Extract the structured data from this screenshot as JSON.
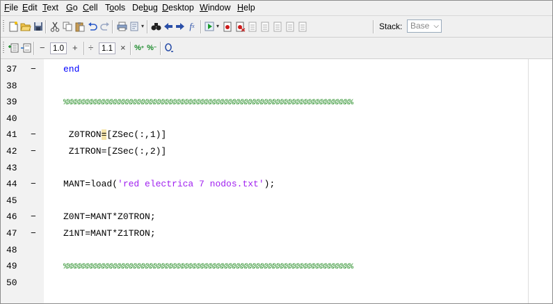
{
  "menu": [
    {
      "pre": "",
      "u": "F",
      "post": "ile"
    },
    {
      "pre": "",
      "u": "E",
      "post": "dit"
    },
    {
      "pre": "",
      "u": "T",
      "post": "ext"
    },
    {
      "pre": "",
      "u": "G",
      "post": "o"
    },
    {
      "pre": "",
      "u": "C",
      "post": "ell"
    },
    {
      "pre": "T",
      "u": "o",
      "post": "ols"
    },
    {
      "pre": "De",
      "u": "b",
      "post": "ug"
    },
    {
      "pre": "",
      "u": "D",
      "post": "esktop"
    },
    {
      "pre": "",
      "u": "W",
      "post": "indow"
    },
    {
      "pre": "",
      "u": "H",
      "post": "elp"
    }
  ],
  "toolbar": {
    "stack_label": "Stack:",
    "stack_value": "Base",
    "cell_minus": "−",
    "cell_value_1": "1.0",
    "cell_plus": "+",
    "cell_divide": "÷",
    "cell_value_2": "1.1",
    "cell_times": "×"
  },
  "editor": {
    "lines": [
      {
        "num": "37",
        "dash": "−",
        "parts": [
          {
            "t": "end",
            "c": "kw"
          }
        ]
      },
      {
        "num": "38",
        "dash": "",
        "parts": []
      },
      {
        "num": "39",
        "dash": "",
        "parts": [
          {
            "t": "%%%%%%%%%%%%%%%%%%%%%%%%%%%%%%%%%%%%%%%%%%%%%%%%%%%%%%%%%%%%%%%%%%%%%%%%%",
            "c": "cm"
          }
        ]
      },
      {
        "num": "40",
        "dash": "",
        "parts": []
      },
      {
        "num": "41",
        "dash": "−",
        "parts": [
          {
            "t": " Z0TRON",
            "c": ""
          },
          {
            "t": "=",
            "c": "hl"
          },
          {
            "t": "[ZSec(:,1)]",
            "c": ""
          }
        ]
      },
      {
        "num": "42",
        "dash": "−",
        "parts": [
          {
            "t": " Z1TRON=[ZSec(:,2)]",
            "c": ""
          }
        ]
      },
      {
        "num": "43",
        "dash": "",
        "parts": []
      },
      {
        "num": "44",
        "dash": "−",
        "parts": [
          {
            "t": "MANT=load(",
            "c": ""
          },
          {
            "t": "'red electrica 7 nodos.txt'",
            "c": "str"
          },
          {
            "t": ");",
            "c": ""
          }
        ]
      },
      {
        "num": "45",
        "dash": "",
        "parts": []
      },
      {
        "num": "46",
        "dash": "−",
        "parts": [
          {
            "t": "Z0NT=MANT*Z0TRON;",
            "c": ""
          }
        ]
      },
      {
        "num": "47",
        "dash": "−",
        "parts": [
          {
            "t": "Z1NT=MANT*Z1TRON;",
            "c": ""
          }
        ]
      },
      {
        "num": "48",
        "dash": "",
        "parts": []
      },
      {
        "num": "49",
        "dash": "",
        "parts": [
          {
            "t": "%%%%%%%%%%%%%%%%%%%%%%%%%%%%%%%%%%%%%%%%%%%%%%%%%%%%%%%%%%%%%%%%%%%%%%%%%",
            "c": "cm"
          }
        ]
      },
      {
        "num": "50",
        "dash": "",
        "parts": []
      }
    ]
  }
}
